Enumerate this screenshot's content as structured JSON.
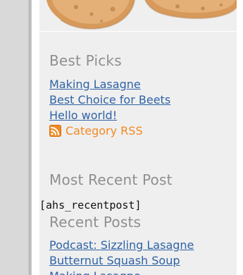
{
  "sidebar": {
    "best_picks": {
      "heading": "Best Picks",
      "links": [
        "Making Lasagne",
        "Best Choice for Beets",
        "Hello world!"
      ],
      "rss": {
        "label": "Category RSS",
        "icon": "rss-icon"
      }
    },
    "most_recent_post": {
      "heading": "Most Recent Post",
      "shortcode": "[ahs_recentpost]"
    },
    "recent_posts": {
      "heading": "Recent Posts",
      "links": [
        "Podcast: Sizzling Lasagne",
        "Butternut Squash Soup",
        "Making Lasagne"
      ]
    }
  },
  "colors": {
    "heading_gray": "#8f8f8f",
    "link_blue": "#2f63a6",
    "rss_orange": "#f08a24",
    "panel_bg": "#efefef"
  }
}
